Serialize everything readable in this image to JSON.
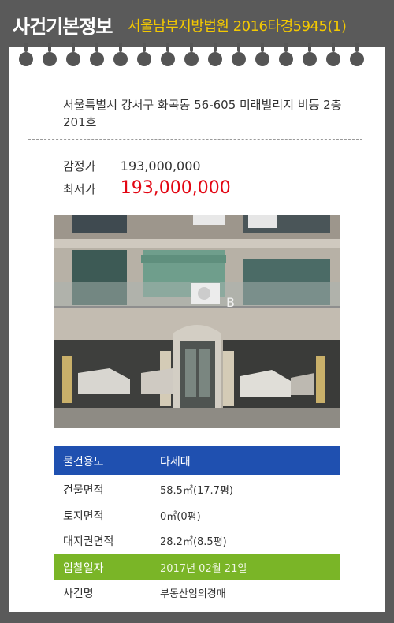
{
  "header": {
    "title": "사건기본정보",
    "case": "서울남부지방법원 2016타경5945(1)"
  },
  "address": "서울특별시 강서구 화곡동 56-605 미래빌리지 비동 2층201호",
  "prices": {
    "appraisal_label": "감정가",
    "appraisal_value": "193,000,000",
    "minimum_label": "최저가",
    "minimum_value": "193,000,000"
  },
  "photo": {
    "building_label": "B"
  },
  "info": {
    "rows": [
      {
        "label": "물건용도",
        "value": "다세대"
      },
      {
        "label": "건물면적",
        "value": "58.5㎡(17.7평)"
      },
      {
        "label": "토지면적",
        "value": "0㎡(0평)"
      },
      {
        "label": "대지권면적",
        "value": "28.2㎡(8.5평)"
      },
      {
        "label": "입찰일자",
        "value": "2017년 02월 21일"
      },
      {
        "label": "사건명",
        "value": "부동산임의경매"
      }
    ]
  },
  "colors": {
    "title_text": "#ffffff",
    "case_text": "#f4c900",
    "min_price": "#e30613",
    "usage_row": "#1f50b0",
    "bid_date_row": "#7ab527"
  }
}
